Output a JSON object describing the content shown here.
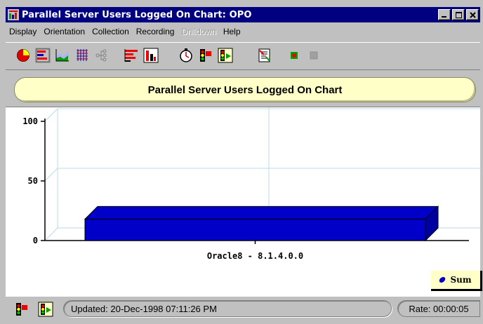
{
  "window": {
    "title": "Parallel Server Users Logged On Chart: OPO",
    "app_icon": "bar-chart-icon",
    "buttons": [
      "minimize",
      "maximize",
      "close"
    ]
  },
  "menu": [
    {
      "label": "Display",
      "enabled": true
    },
    {
      "label": "Orientation",
      "enabled": true
    },
    {
      "label": "Collection",
      "enabled": true
    },
    {
      "label": "Recording",
      "enabled": true
    },
    {
      "label": "Drilldown",
      "enabled": false
    },
    {
      "label": "Help",
      "enabled": true
    }
  ],
  "toolbar": {
    "icons": [
      "pie-chart-icon",
      "horizontal-bar-chart-icon",
      "area-chart-icon",
      "grid-chart-icon",
      "tree-chart-icon",
      "stacked-bar-icon",
      "vertical-bar-chart-icon",
      "timer-icon",
      "stop-collection-icon",
      "start-collection-icon",
      "report-icon",
      "record-icon",
      "stop-record-icon"
    ]
  },
  "chart_title": "Parallel Server Users Logged On Chart",
  "chart_data": {
    "type": "bar",
    "orientation": "horizontal-3d",
    "categories": [
      "Oracle8 - 8.1.4.0.0"
    ],
    "series": [
      {
        "name": "Sum",
        "values": [
          18
        ]
      }
    ],
    "yticks": [
      "100",
      "50",
      "0"
    ],
    "ylim": [
      0,
      100
    ],
    "grid": true,
    "legend": "bottom-right",
    "bar_color": "#0000c8"
  },
  "legend": {
    "label": "Sum"
  },
  "status": {
    "updated": "Updated: 20-Dec-1998 07:11:26 PM",
    "rate": "Rate: 00:00:05"
  }
}
